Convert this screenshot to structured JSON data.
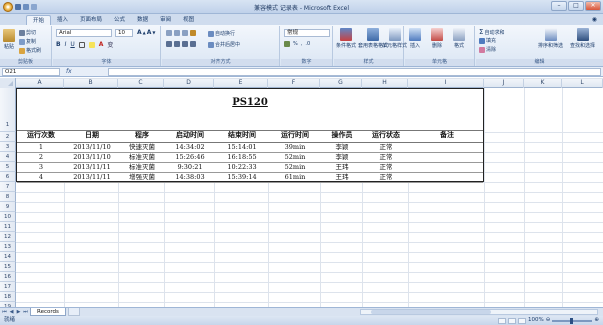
{
  "window": {
    "title": "记录表 - Microsoft Excel",
    "title_prefix": "兼容模式"
  },
  "tabs": [
    "开始",
    "插入",
    "页面布局",
    "公式",
    "数据",
    "审阅",
    "视图"
  ],
  "ribbon": {
    "clipboard": {
      "paste": "粘贴",
      "cut": "剪切",
      "copy": "复制",
      "format_painter": "格式刷",
      "label": "剪贴板"
    },
    "font": {
      "name": "Arial",
      "size": "10",
      "label": "字体"
    },
    "alignment": {
      "wrap": "自动换行",
      "merge": "合并后居中",
      "label": "对齐方式"
    },
    "number": {
      "format": "常规",
      "label": "数字"
    },
    "styles": {
      "conditional": "条件格式",
      "table": "套用表格格式",
      "cell_styles": "单元格样式",
      "label": "样式"
    },
    "cells": {
      "insert": "插入",
      "delete": "删除",
      "format": "格式",
      "label": "单元格"
    },
    "editing": {
      "autosum": "自动求和",
      "fill": "填充",
      "clear": "清除",
      "sort": "排序和筛选",
      "find": "查找和选择",
      "label": "编辑"
    }
  },
  "formula_bar": {
    "name_box": "O21",
    "fx": "fx",
    "value": ""
  },
  "columns": [
    "A",
    "B",
    "C",
    "D",
    "E",
    "F",
    "G",
    "H",
    "I",
    "J",
    "K",
    "L"
  ],
  "rows": [
    "1",
    "2",
    "3",
    "4",
    "5",
    "6",
    "7",
    "8",
    "9",
    "10",
    "11",
    "12",
    "13",
    "14",
    "15",
    "16",
    "17",
    "18",
    "19"
  ],
  "sheet": {
    "title": "PS120",
    "headers": [
      "运行次数",
      "日期",
      "程序",
      "启动时间",
      "结束时间",
      "运行时间",
      "操作员",
      "运行状态",
      "备注"
    ],
    "records": [
      [
        "1",
        "2013/11/10",
        "快速灭菌",
        "14:34:02",
        "15:14:01",
        "39min",
        "李颖",
        "正常",
        ""
      ],
      [
        "2",
        "2013/11/10",
        "标准灭菌",
        "15:26:46",
        "16:18:55",
        "52min",
        "李颖",
        "正常",
        ""
      ],
      [
        "3",
        "2013/11/11",
        "标准灭菌",
        "9:30:21",
        "10:22:33",
        "52min",
        "王玮",
        "正常",
        ""
      ],
      [
        "4",
        "2013/11/11",
        "增强灭菌",
        "14:38:03",
        "15:39:14",
        "61min",
        "王玮",
        "正常",
        ""
      ]
    ]
  },
  "sheet_tabs": [
    "Records"
  ],
  "status": {
    "ready": "就绪",
    "zoom": "100%"
  }
}
